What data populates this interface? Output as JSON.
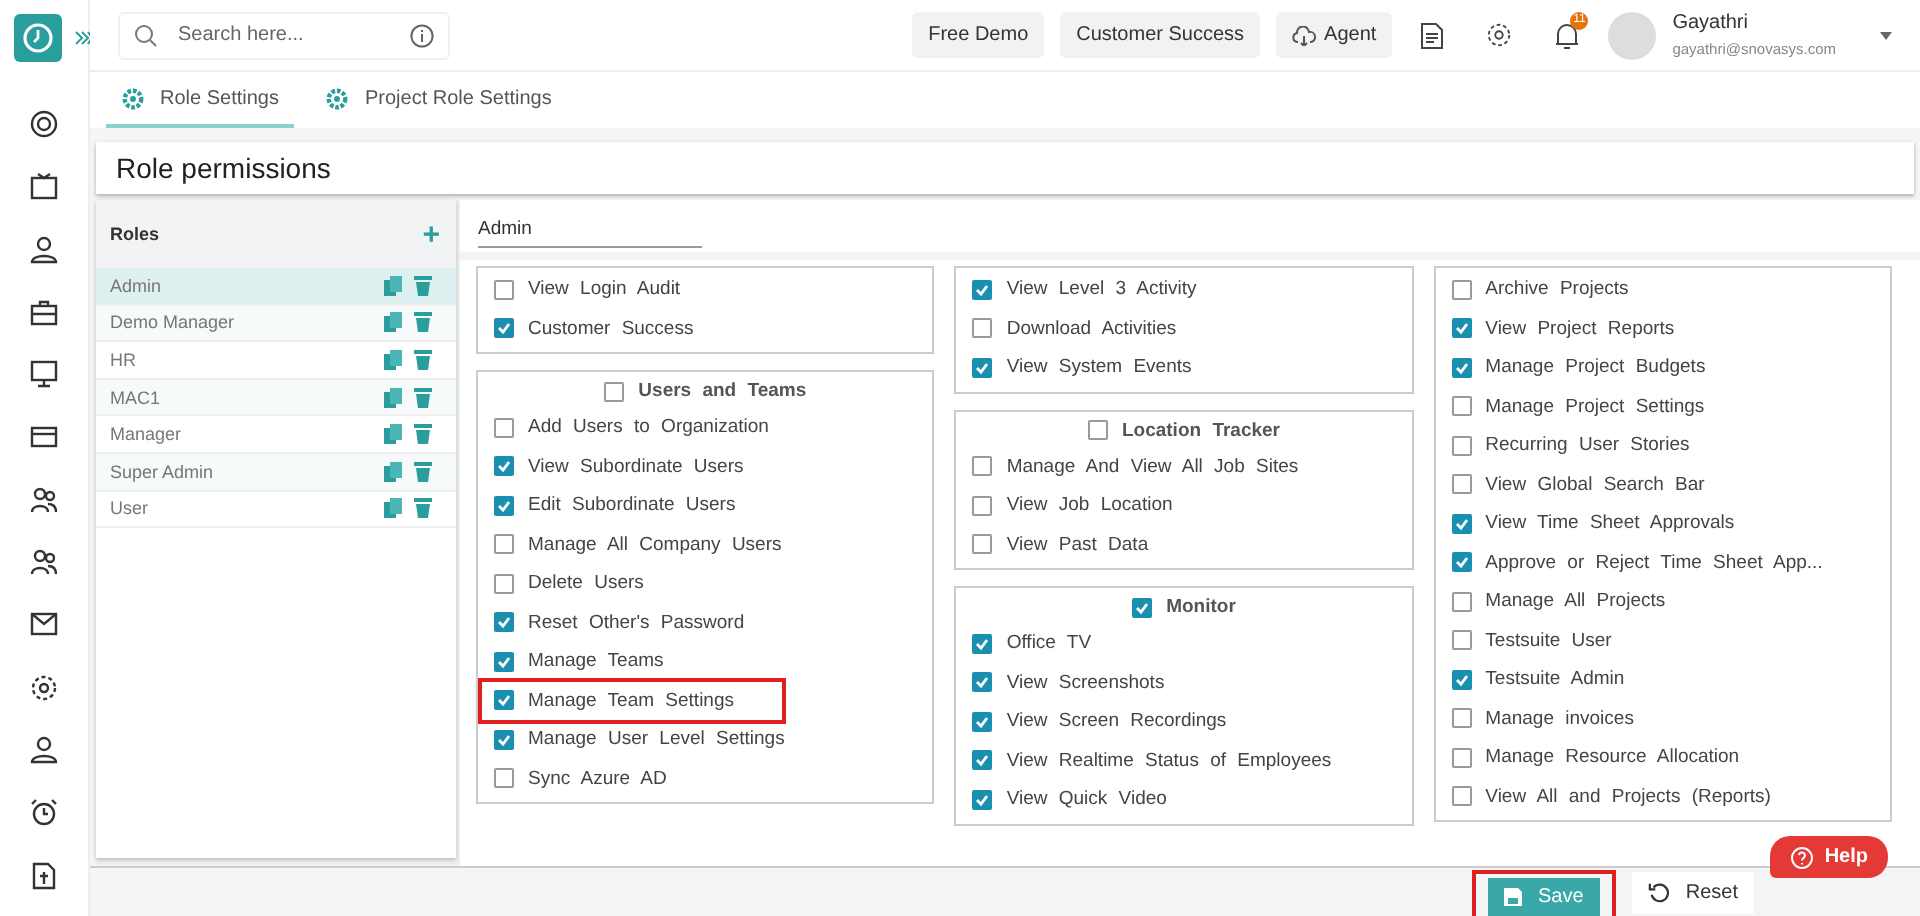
{
  "search": {
    "placeholder": "Search here..."
  },
  "header_buttons": [
    {
      "label": "Free Demo",
      "kind": "plain"
    },
    {
      "label": "Customer Success",
      "kind": "plain"
    },
    {
      "label": "Agent",
      "kind": "cloud"
    }
  ],
  "notifications": {
    "count": "11"
  },
  "user": {
    "name": "Gayathri",
    "email": "gayathri@snovasys.com"
  },
  "tabs": [
    {
      "label": "Role Settings",
      "selected": true
    },
    {
      "label": "Project Role Settings",
      "selected": false
    }
  ],
  "page_title": "Role permissions",
  "roles": {
    "title": "Roles",
    "add": "+",
    "items": [
      {
        "name": "Admin",
        "selected": true
      },
      {
        "name": "Demo Manager",
        "selected": false
      },
      {
        "name": "HR",
        "selected": false
      },
      {
        "name": "MAC1",
        "selected": false
      },
      {
        "name": "Manager",
        "selected": false
      },
      {
        "name": "Super Admin",
        "selected": false
      },
      {
        "name": "User",
        "selected": false
      }
    ]
  },
  "selected_role": "Admin",
  "columns": [
    [
      {
        "items": [
          {
            "label": "View Login Audit",
            "checked": false
          },
          {
            "label": "Customer Success",
            "checked": true
          }
        ]
      },
      {
        "title": "Users and Teams",
        "checked": false,
        "items": [
          {
            "label": "Add Users to Organization",
            "checked": false
          },
          {
            "label": "View Subordinate Users",
            "checked": true
          },
          {
            "label": "Edit Subordinate Users",
            "checked": true
          },
          {
            "label": "Manage All Company Users",
            "checked": false
          },
          {
            "label": "Delete Users",
            "checked": false
          },
          {
            "label": "Reset Other's Password",
            "checked": true
          },
          {
            "label": "Manage Teams",
            "checked": true
          },
          {
            "label": "Manage Team Settings",
            "checked": true,
            "highlighted": true
          },
          {
            "label": "Manage User Level Settings",
            "checked": true
          },
          {
            "label": "Sync Azure AD",
            "checked": false
          }
        ]
      }
    ],
    [
      {
        "items": [
          {
            "label": "View Level 3 Activity",
            "checked": true
          },
          {
            "label": "Download Activities",
            "checked": false
          },
          {
            "label": "View System Events",
            "checked": true
          }
        ]
      },
      {
        "title": "Location Tracker",
        "checked": false,
        "items": [
          {
            "label": "Manage And View All Job Sites",
            "checked": false
          },
          {
            "label": "View Job Location",
            "checked": false
          },
          {
            "label": "View Past Data",
            "checked": false
          }
        ]
      },
      {
        "title": "Monitor",
        "checked": true,
        "items": [
          {
            "label": "Office TV",
            "checked": true
          },
          {
            "label": "View Screenshots",
            "checked": true
          },
          {
            "label": "View Screen Recordings",
            "checked": true
          },
          {
            "label": "View Realtime Status of Employees",
            "checked": true
          },
          {
            "label": "View Quick Video",
            "checked": true
          }
        ]
      }
    ],
    [
      {
        "items": [
          {
            "label": "Archive Projects",
            "checked": false
          },
          {
            "label": "View Project Reports",
            "checked": true
          },
          {
            "label": "Manage Project Budgets",
            "checked": true
          },
          {
            "label": "Manage Project Settings",
            "checked": false
          },
          {
            "label": "Recurring User Stories",
            "checked": false
          },
          {
            "label": "View Global Search Bar",
            "checked": false
          },
          {
            "label": "View Time Sheet Approvals",
            "checked": true
          },
          {
            "label": "Approve or Reject Time Sheet App...",
            "checked": true
          },
          {
            "label": "Manage All Projects",
            "checked": false
          },
          {
            "label": "Testsuite User",
            "checked": false
          },
          {
            "label": "Testsuite Admin",
            "checked": true
          },
          {
            "label": "Manage invoices",
            "checked": false
          },
          {
            "label": "Manage Resource Allocation",
            "checked": false
          },
          {
            "label": "View All and Projects (Reports)",
            "checked": false
          }
        ]
      }
    ]
  ],
  "actions": {
    "save": {
      "label": "Save",
      "highlighted": true
    },
    "reset": "Reset"
  },
  "help": "Help"
}
